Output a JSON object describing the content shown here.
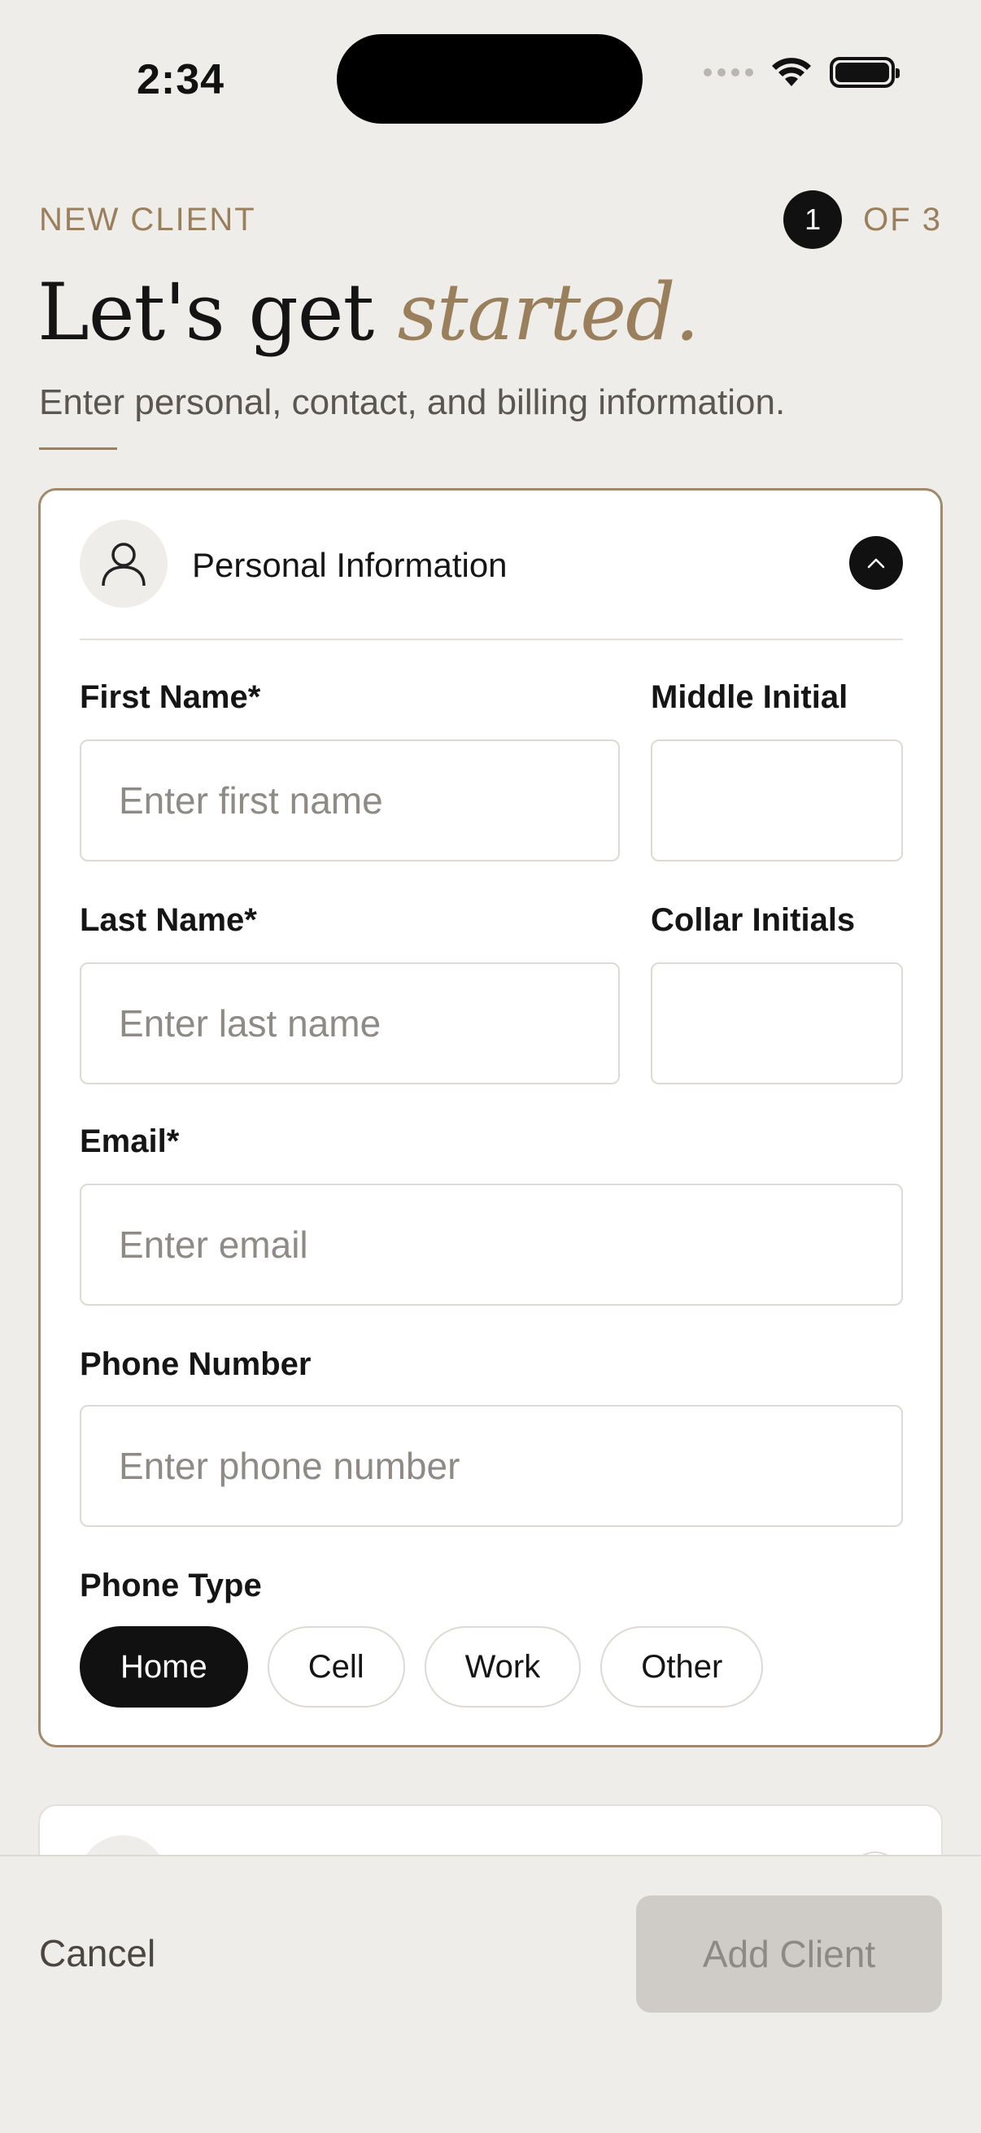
{
  "status_bar": {
    "time": "2:34"
  },
  "header": {
    "eyebrow": "NEW CLIENT",
    "step_current": "1",
    "step_total": "OF 3",
    "headline_main": "Let's get ",
    "headline_accent": "started.",
    "subtitle": "Enter personal, contact, and billing information."
  },
  "personal_card": {
    "title": "Personal Information",
    "first_name": {
      "label": "First Name*",
      "placeholder": "Enter first name",
      "value": ""
    },
    "middle_initial": {
      "label": "Middle Initial",
      "value": ""
    },
    "last_name": {
      "label": "Last Name*",
      "placeholder": "Enter last name",
      "value": ""
    },
    "collar_initials": {
      "label": "Collar Initials",
      "value": ""
    },
    "email": {
      "label": "Email*",
      "placeholder": "Enter email",
      "value": ""
    },
    "phone": {
      "label": "Phone Number",
      "placeholder": "Enter phone number",
      "value": ""
    },
    "phone_type": {
      "label": "Phone Type",
      "options": [
        "Home",
        "Cell",
        "Work",
        "Other"
      ],
      "selected": "Home"
    }
  },
  "footer": {
    "cancel_label": "Cancel",
    "add_label": "Add Client"
  },
  "colors": {
    "accent": "#9A7F5D",
    "background": "#EFEDE9",
    "primary": "#111111",
    "disabled": "#CFCCC7"
  },
  "icons": {
    "avatar": "person-icon",
    "collapse": "chevron-up-icon"
  }
}
